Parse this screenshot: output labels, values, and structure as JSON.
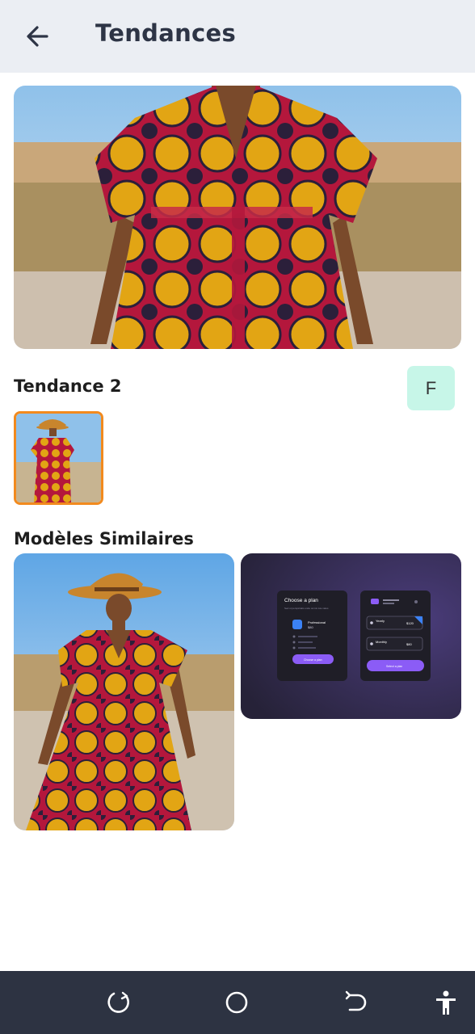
{
  "header": {
    "title": "Tendances"
  },
  "section1": {
    "title": "Tendance 2",
    "badge": "F"
  },
  "section2": {
    "title": "Modèles Similaires"
  },
  "plan_card": {
    "heading": "Choose a plan",
    "subheading": "Sed ut perspiciatis unde omnis iste natus",
    "plan_name": "Professional",
    "plan_price": "$80",
    "plan_button": "Choose a plan",
    "options": [
      {
        "label": "Yearly",
        "price": "$120"
      },
      {
        "label": "Monthly",
        "price": "$80"
      }
    ],
    "select_button": "Select a plan"
  },
  "colors": {
    "appbar": "#ebeef3",
    "navbar": "#2d3342",
    "accent_orange": "#f28a1e",
    "badge_bg": "#c7f6e8",
    "plan_purple": "#8b5cf6"
  },
  "icons": {
    "back": "arrow-left-icon",
    "nav_recent": "recent-apps-icon",
    "nav_home": "home-circle-icon",
    "nav_back": "back-nav-icon",
    "nav_accessibility": "accessibility-icon"
  }
}
